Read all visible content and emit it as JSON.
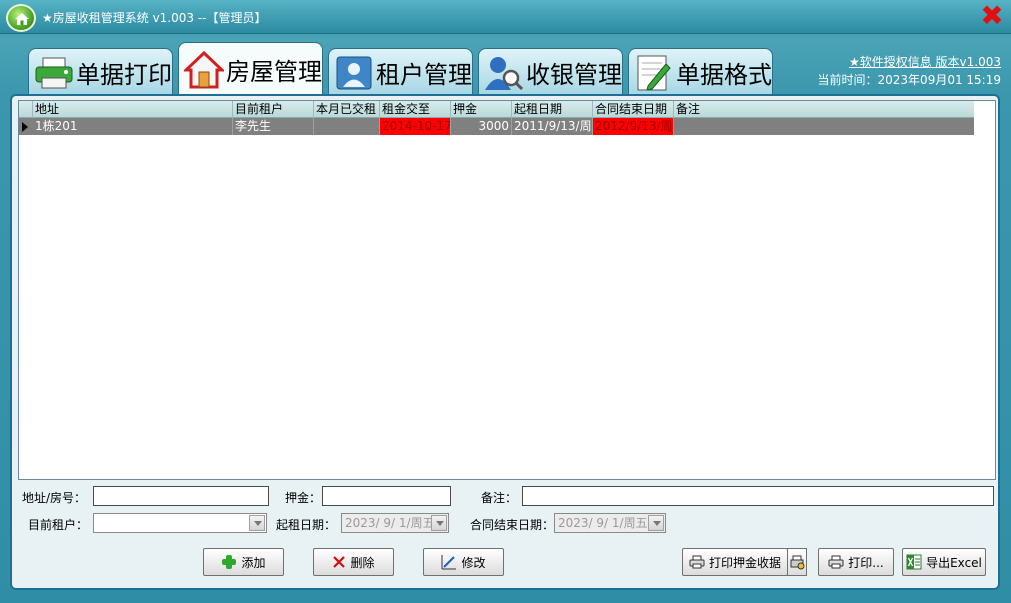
{
  "window": {
    "title": "★房屋收租管理系统 v1.003   --【管理员】",
    "close_icon": "close-icon"
  },
  "tabs": [
    {
      "label": "单据打印",
      "icon": "printer-icon",
      "active": false
    },
    {
      "label": "房屋管理",
      "icon": "house-icon",
      "active": true
    },
    {
      "label": "租户管理",
      "icon": "person-icon",
      "active": false
    },
    {
      "label": "收银管理",
      "icon": "person-search-icon",
      "active": false
    },
    {
      "label": "单据格式",
      "icon": "document-edit-icon",
      "active": false
    }
  ],
  "header": {
    "license_link": "★软件授权信息 版本v1.003",
    "current_time": "当前时间：2023年09月01 15:19"
  },
  "grid": {
    "columns": [
      "地址",
      "目前租户",
      "本月已交租",
      "租金交至",
      "押金",
      "起租日期",
      "合同结束日期",
      "备注"
    ],
    "rows": [
      {
        "address": "1栋201",
        "tenant": "李先生",
        "paid_this_month": "",
        "rent_paid_until": "2014-10-17",
        "deposit": "3000",
        "start_date": "2011/9/13/周",
        "contract_end": "2012/9/13/周",
        "remark": ""
      }
    ]
  },
  "form": {
    "address_label": "地址/房号：",
    "address_value": "",
    "deposit_label": "押金：",
    "deposit_value": "",
    "remark_label": "备注：",
    "remark_value": "",
    "tenant_label": "目前租户：",
    "tenant_value": "",
    "start_date_label": "起租日期：",
    "start_date_value": "2023/ 9/ 1/周五",
    "end_date_label": "合同结束日期：",
    "end_date_value": "2023/ 9/ 1/周五"
  },
  "buttons": {
    "add": "添加",
    "delete": "删除",
    "modify": "修改",
    "print_deposit": "打印押金收据",
    "print": "打印...",
    "export_excel": "导出Excel"
  },
  "colors": {
    "accent": "#2f8ea6",
    "highlight_red": "#ff0000",
    "selected_row": "#808080"
  }
}
